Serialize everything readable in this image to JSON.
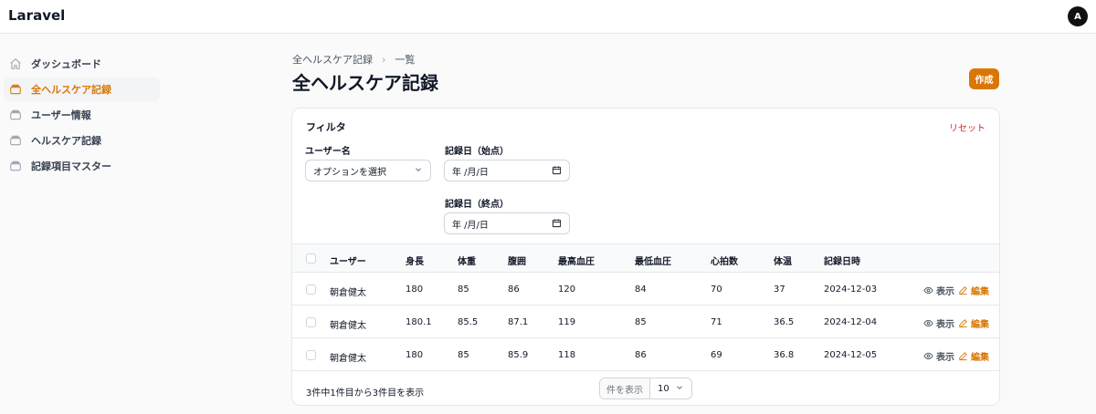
{
  "app": {
    "brand": "Laravel",
    "avatar_initial": "A",
    "accent": "#d97706"
  },
  "sidebar": {
    "items": [
      {
        "label": "ダッシュボード",
        "icon": "home-icon",
        "active": false
      },
      {
        "label": "全ヘルスケア記録",
        "icon": "stack-icon",
        "active": true
      },
      {
        "label": "ユーザー情報",
        "icon": "stack-icon",
        "active": false
      },
      {
        "label": "ヘルスケア記録",
        "icon": "stack-icon",
        "active": false
      },
      {
        "label": "記録項目マスター",
        "icon": "stack-icon",
        "active": false
      }
    ]
  },
  "breadcrumb": {
    "items": [
      "全ヘルスケア記録",
      "一覧"
    ]
  },
  "page": {
    "title": "全ヘルスケア記録",
    "create_label": "作成"
  },
  "filters": {
    "title": "フィルタ",
    "reset_label": "リセット",
    "user_label": "ユーザー名",
    "user_value": "オプションを選択",
    "date_from_label": "記録日（始点）",
    "date_from_value": "年 /月/日",
    "date_to_label": "記録日（終点）",
    "date_to_value": "年 /月/日"
  },
  "table": {
    "columns": [
      "ユーザー",
      "身長",
      "体重",
      "腹囲",
      "最高血圧",
      "最低血圧",
      "心拍数",
      "体温",
      "記録日時"
    ],
    "view_label": "表示",
    "edit_label": "編集",
    "rows": [
      [
        "朝倉健太",
        "180",
        "85",
        "86",
        "120",
        "84",
        "70",
        "37",
        "2024-12-03"
      ],
      [
        "朝倉健太",
        "180.1",
        "85.5",
        "87.1",
        "119",
        "85",
        "71",
        "36.5",
        "2024-12-04"
      ],
      [
        "朝倉健太",
        "180",
        "85",
        "85.9",
        "118",
        "86",
        "69",
        "36.8",
        "2024-12-05"
      ]
    ]
  },
  "pagination": {
    "summary": "3件中1件目から3件目を表示",
    "per_page_label": "件を表示",
    "per_page_value": "10"
  }
}
